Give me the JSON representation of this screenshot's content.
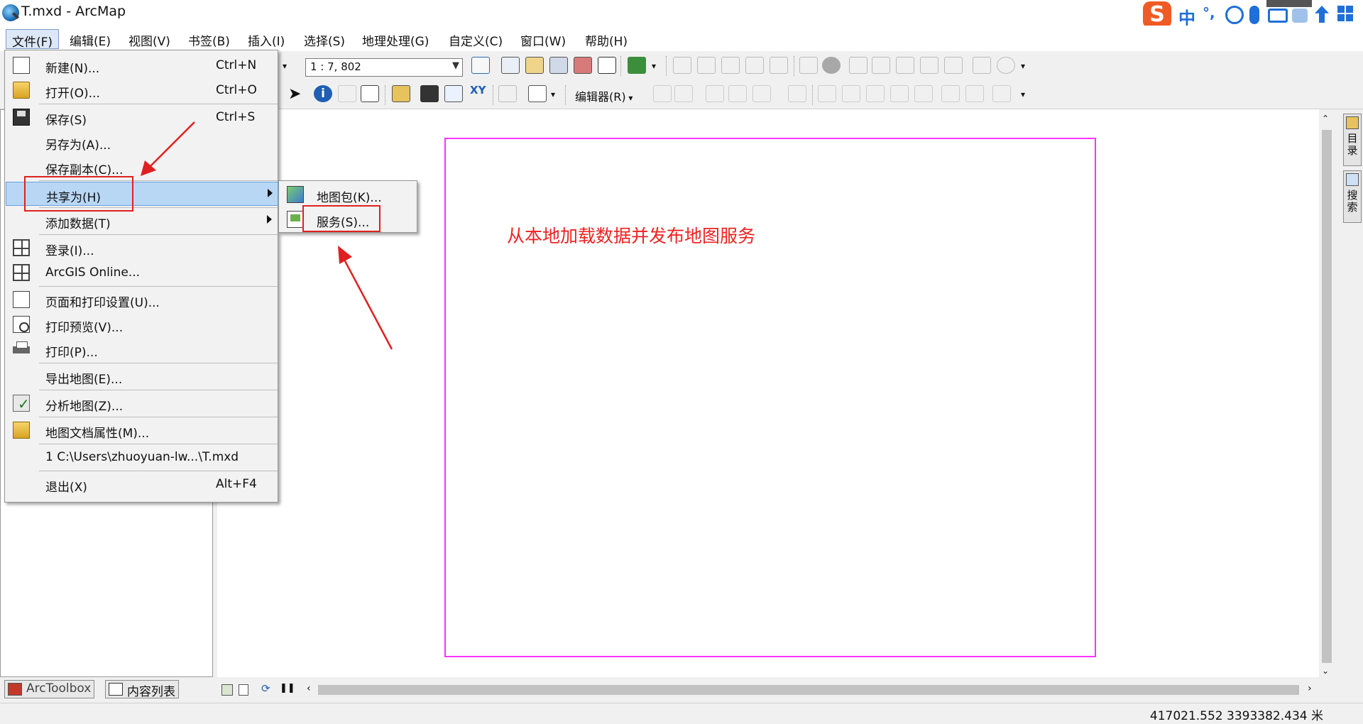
{
  "window": {
    "title": "T.mxd - ArcMap"
  },
  "ime": {
    "logo": "S",
    "lang": "中",
    "punct": "°,"
  },
  "menubar": [
    {
      "key": "file",
      "label": "文件(F)"
    },
    {
      "key": "edit",
      "label": "编辑(E)"
    },
    {
      "key": "view",
      "label": "视图(V)"
    },
    {
      "key": "bookmarks",
      "label": "书签(B)"
    },
    {
      "key": "insert",
      "label": "插入(I)"
    },
    {
      "key": "select",
      "label": "选择(S)"
    },
    {
      "key": "geoprocessing",
      "label": "地理处理(G)"
    },
    {
      "key": "customize",
      "label": "自定义(C)"
    },
    {
      "key": "windows",
      "label": "窗口(W)"
    },
    {
      "key": "help",
      "label": "帮助(H)"
    }
  ],
  "toolbar": {
    "scale": "1 : 7, 802",
    "editor_label": "编辑器(R)"
  },
  "file_menu": [
    {
      "label": "新建(N)...",
      "shortcut": "Ctrl+N",
      "icon": "new-document-icon"
    },
    {
      "label": "打开(O)...",
      "shortcut": "Ctrl+O",
      "icon": "open-folder-icon"
    },
    {
      "label": "保存(S)",
      "shortcut": "Ctrl+S",
      "icon": "save-disk-icon"
    },
    {
      "label": "另存为(A)...",
      "shortcut": "",
      "icon": ""
    },
    {
      "label": "保存副本(C)...",
      "shortcut": "",
      "icon": ""
    },
    {
      "label": "共享为(H)",
      "shortcut": "",
      "icon": "",
      "submenu": true,
      "highlighted": true
    },
    {
      "label": "添加数据(T)",
      "shortcut": "",
      "icon": "",
      "submenu": true
    },
    {
      "label": "登录(I)...",
      "shortcut": "",
      "icon": "sign-in-grid-icon"
    },
    {
      "label": "ArcGIS Online...",
      "shortcut": "",
      "icon": "arcgis-online-grid-icon"
    },
    {
      "label": "页面和打印设置(U)...",
      "shortcut": "",
      "icon": "page-setup-icon"
    },
    {
      "label": "打印预览(V)...",
      "shortcut": "",
      "icon": "print-preview-icon"
    },
    {
      "label": "打印(P)...",
      "shortcut": "",
      "icon": "printer-icon"
    },
    {
      "label": "导出地图(E)...",
      "shortcut": "",
      "icon": ""
    },
    {
      "label": "分析地图(Z)...",
      "shortcut": "",
      "icon": "analyze-map-icon"
    },
    {
      "label": "地图文档属性(M)...",
      "shortcut": "",
      "icon": "document-properties-icon"
    },
    {
      "label": "1 C:\\Users\\zhuoyuan-lw...\\T.mxd",
      "shortcut": "",
      "icon": ""
    },
    {
      "label": "退出(X)",
      "shortcut": "Alt+F4",
      "icon": ""
    }
  ],
  "share_submenu": [
    {
      "label": "地图包(K)...",
      "icon": "map-package-icon"
    },
    {
      "label": "服务(S)...",
      "icon": "service-icon"
    }
  ],
  "annotation": "从本地加载数据并发布地图服务",
  "left_tabs": {
    "arctoolbox": "ArcToolbox",
    "toc": "内容列表"
  },
  "right_dock": {
    "catalog": "目录",
    "search": "搜索"
  },
  "status": {
    "coords": "417021.552  3393382.434 米"
  },
  "colors": {
    "layout_border": "#ff33ff",
    "annotation": "#ee2222",
    "menu_highlight": "#b7d7f5"
  }
}
